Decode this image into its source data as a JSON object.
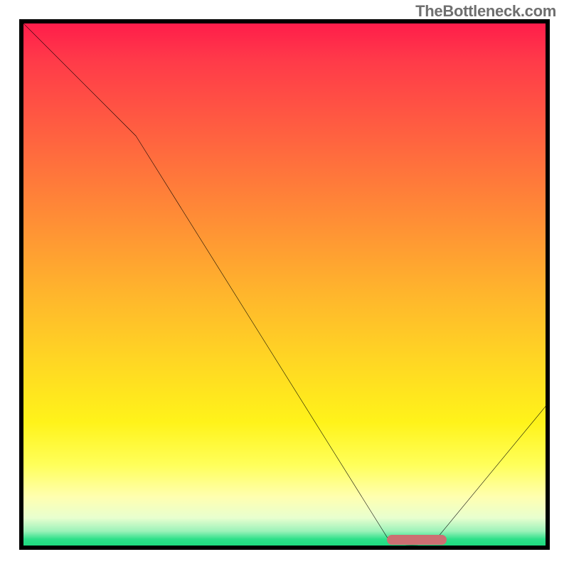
{
  "attribution": "TheBottleneck.com",
  "chart_data": {
    "type": "line",
    "title": "",
    "xlabel": "",
    "ylabel": "",
    "xlim": [
      0,
      100
    ],
    "ylim": [
      0,
      100
    ],
    "x": [
      0,
      22,
      72,
      78,
      100
    ],
    "values": [
      100,
      78,
      1,
      1,
      28
    ],
    "optimum_range_x": [
      70,
      80
    ],
    "colors": {
      "worst": "#ff1a4b",
      "mid": "#ffd823",
      "best": "#14d878",
      "marker": "#cc6f72",
      "curve": "#000000"
    }
  }
}
